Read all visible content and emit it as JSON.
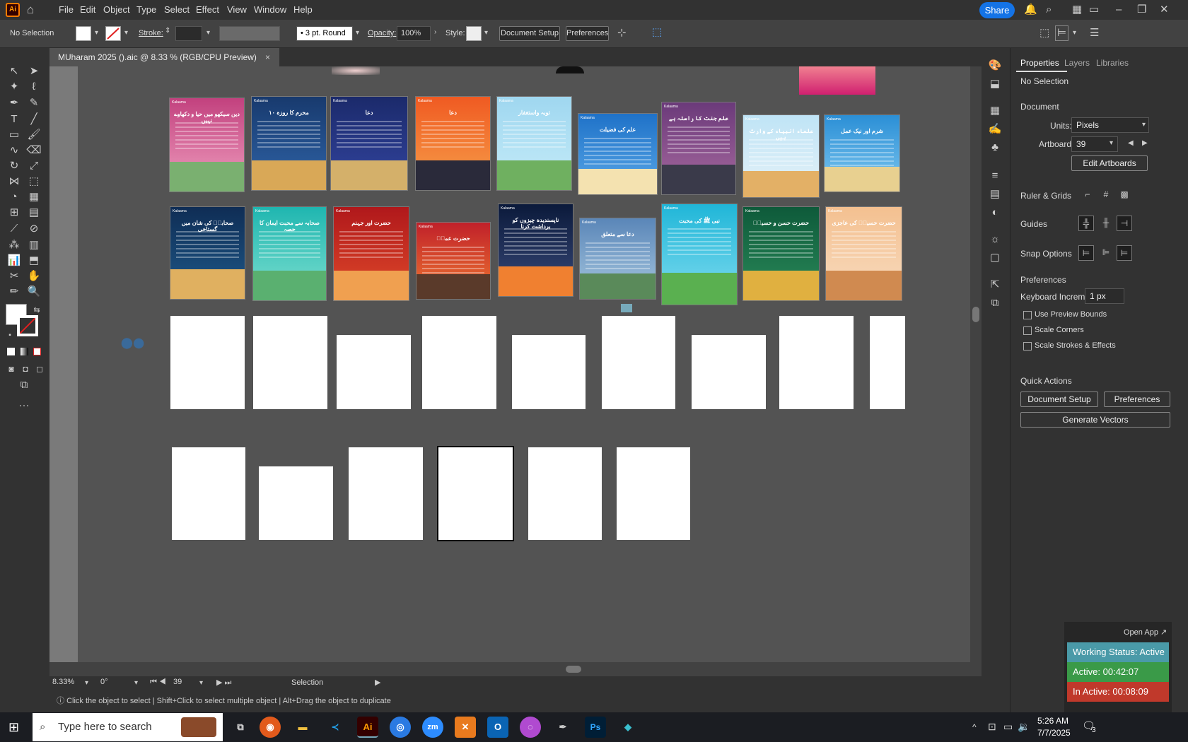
{
  "menubar": {
    "app_logo": "Ai",
    "items": [
      "File",
      "Edit",
      "Object",
      "Type",
      "Select",
      "Effect",
      "View",
      "Window",
      "Help"
    ],
    "share": "Share"
  },
  "control": {
    "selection": "No Selection",
    "stroke_label": "Stroke:",
    "brush": "3 pt. Round",
    "opacity_label": "Opacity:",
    "opacity": "100%",
    "style_label": "Style:",
    "doc_setup": "Document Setup",
    "preferences": "Preferences"
  },
  "document": {
    "tab_title": "MUharam 2025 ().aic @ 8.33 % (RGB/CPU Preview)",
    "close": "×"
  },
  "posts": {
    "brand": "Kalaama",
    "row1": [
      {
        "title": "دین سیکھو میں حیا و دکھاوے نہیں",
        "colors": [
          "#c2417e",
          "#f0a0c0",
          "#7ab070"
        ]
      },
      {
        "title": "۱۰ محرم کا روزہ",
        "colors": [
          "#183a6e",
          "#2f64a8",
          "#d9a857"
        ]
      },
      {
        "title": "دعا",
        "colors": [
          "#1b2a6b",
          "#3345a0",
          "#d4b06a"
        ]
      },
      {
        "title": "دعا",
        "colors": [
          "#f05a22",
          "#f6a04a",
          "#2a2a3a"
        ]
      },
      {
        "title": "توبہ واستغفار",
        "colors": [
          "#9fd7f0",
          "#c6ecf8",
          "#6fb060"
        ]
      },
      {
        "title": "علم کی فضیلت",
        "colors": [
          "#1f72c8",
          "#5aa8e8",
          "#f4e2b0"
        ]
      },
      {
        "title": "علم جنت کا راستہ ہے",
        "colors": [
          "#6b3a7a",
          "#a86aa0",
          "#3a3a4a"
        ]
      },
      {
        "title": "علماء انبیاء کے وارث ہیں",
        "colors": [
          "#bfe4f6",
          "#e6f2f8",
          "#e3b066"
        ]
      },
      {
        "title": "شرم اور نیک عمل",
        "colors": [
          "#2b8fd6",
          "#7fc8f0",
          "#e8d090"
        ]
      }
    ],
    "row2": [
      {
        "title": "صحابہؓ کی شان میں گستاخی",
        "colors": [
          "#0f2d55",
          "#1f5a8a",
          "#e0b060"
        ]
      },
      {
        "title": "صحابہ سے محبت ایمان کا حصہ",
        "colors": [
          "#1fb6b0",
          "#7ee0d0",
          "#5ab070"
        ]
      },
      {
        "title": "حضرت اور جہنم",
        "colors": [
          "#b0181b",
          "#e04a2a",
          "#f0a050"
        ]
      },
      {
        "title": "حضرت عمرؓ",
        "colors": [
          "#c0202a",
          "#f07a30",
          "#5a3a2a"
        ]
      },
      {
        "title": "ناپسندیدہ چیزوں کو برداشت کرنا",
        "colors": [
          "#0b1a3b",
          "#3a4a7a",
          "#f08030"
        ]
      },
      {
        "title": "دعا سے متعلق",
        "colors": [
          "#5a86b8",
          "#a8c8e0",
          "#5a8a5a"
        ]
      },
      {
        "title": "نبی ﷺ کی محبت",
        "colors": [
          "#20b6d8",
          "#80dcf0",
          "#5ab050"
        ]
      },
      {
        "title": "حضرت حسن و حسینؓ",
        "colors": [
          "#0e5a3a",
          "#2a8a5a",
          "#e0b040"
        ]
      },
      {
        "title": "حضرت حسینؓ کی عاجزی",
        "colors": [
          "#f4c090",
          "#f8dcc0",
          "#d08a50"
        ]
      }
    ]
  },
  "status": {
    "zoom": "8.33%",
    "rotation": "0°",
    "artboard": "39",
    "tool": "Selection"
  },
  "hint": {
    "text": "Click the object to select  |  Shift+Click to select multiple object  |  Alt+Drag the object to duplicate"
  },
  "panel": {
    "tabs": [
      "Properties",
      "Layers",
      "Libraries"
    ],
    "no_selection": "No Selection",
    "document_label": "Document",
    "units_label": "Units:",
    "units": "Pixels",
    "artboard_label": "Artboard:",
    "artboard": "39",
    "edit_artboards": "Edit Artboards",
    "ruler_grids": "Ruler & Grids",
    "guides": "Guides",
    "snap_options": "Snap Options",
    "preferences": "Preferences",
    "kbd_label": "Keyboard Increment:",
    "kbd_value": "1 px",
    "use_preview_bounds": "Use Preview Bounds",
    "scale_corners": "Scale Corners",
    "scale_strokes": "Scale Strokes & Effects",
    "quick_actions": "Quick Actions",
    "document_setup": "Document Setup",
    "preferences_btn": "Preferences",
    "generate_vectors": "Generate Vectors"
  },
  "widget": {
    "open_app": "Open App ↗",
    "working": "Working Status: Active",
    "active": "Active: 00:42:07",
    "inactive": "In Active: 00:08:09",
    "colors": {
      "working": "#4a9aa8",
      "active": "#3a9a48",
      "inactive": "#c0392b"
    }
  },
  "taskbar": {
    "search_placeholder": "Type here to search",
    "time": "5:26 AM",
    "date": "7/7/2025",
    "notif": "3"
  }
}
